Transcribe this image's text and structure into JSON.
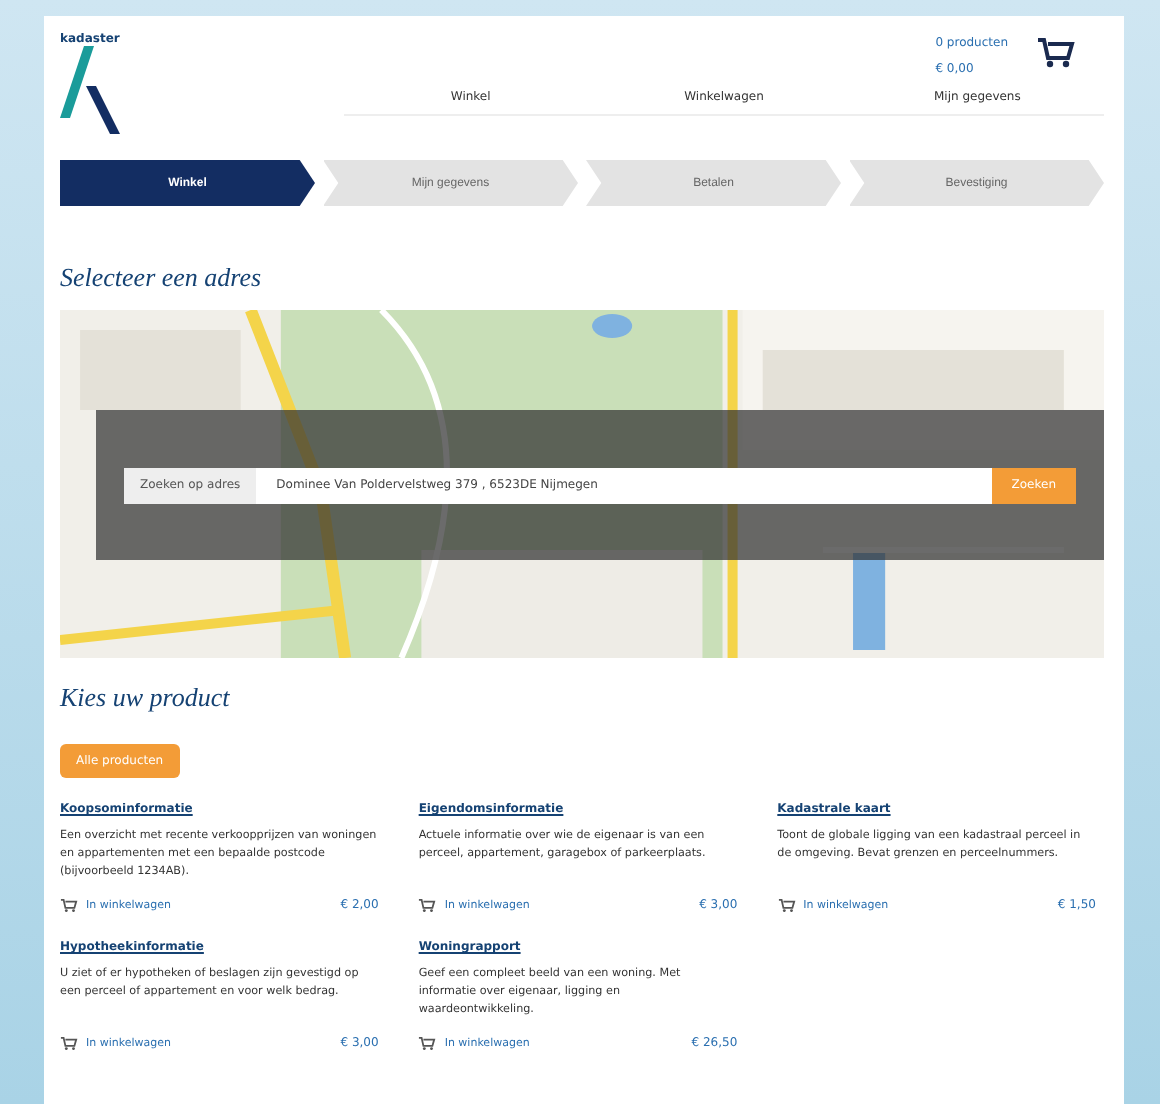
{
  "header": {
    "logo": "kadaster",
    "cart_count": "0 producten",
    "cart_total": "€ 0,00",
    "nav": [
      {
        "label": "Winkel"
      },
      {
        "label": "Winkelwagen"
      },
      {
        "label": "Mijn gegevens"
      }
    ]
  },
  "steps": [
    {
      "label": "Winkel",
      "selected": true
    },
    {
      "label": "Mijn gegevens",
      "selected": false
    },
    {
      "label": "Betalen",
      "selected": false
    },
    {
      "label": "Bevestiging",
      "selected": false
    }
  ],
  "address": {
    "heading": "Selecteer een adres",
    "search_label": "Zoeken op adres",
    "search_value": "Dominee Van Poldervelstweg 379 , 6523DE Nijmegen",
    "search_button": "Zoeken"
  },
  "products": {
    "heading": "Kies uw product",
    "all_button": "Alle producten",
    "items": [
      {
        "title": "Koopsominformatie",
        "description": "Een overzicht met recente verkoopprijzen van woningen en appartementen met een bepaalde postcode (bijvoorbeeld 1234AB).",
        "link": "In winkelwagen",
        "price": "€ 2,00"
      },
      {
        "title": "Eigendomsinformatie",
        "description": "Actuele informatie over wie de eigenaar is van een perceel, appartement, garagebox of parkeerplaats.",
        "link": "In winkelwagen",
        "price": "€ 3,00"
      },
      {
        "title": "Kadastrale kaart",
        "description": "Toont de globale ligging van een kadastraal perceel in de omgeving. Bevat grenzen en perceelnummers.",
        "link": "In winkelwagen",
        "price": "€ 1,50"
      },
      {
        "title": "Hypotheekinformatie",
        "description": "U ziet of er hypotheken of beslagen zijn gevestigd op een perceel of appartement en voor welk bedrag.",
        "link": "In winkelwagen",
        "price": "€ 3,00"
      },
      {
        "title": "Woningrapport",
        "description": "Geef een compleet beeld van een woning. Met informatie over eigenaar, ligging en waardeontwikkeling.",
        "link": "In winkelwagen",
        "price": "€ 26,50"
      }
    ]
  }
}
